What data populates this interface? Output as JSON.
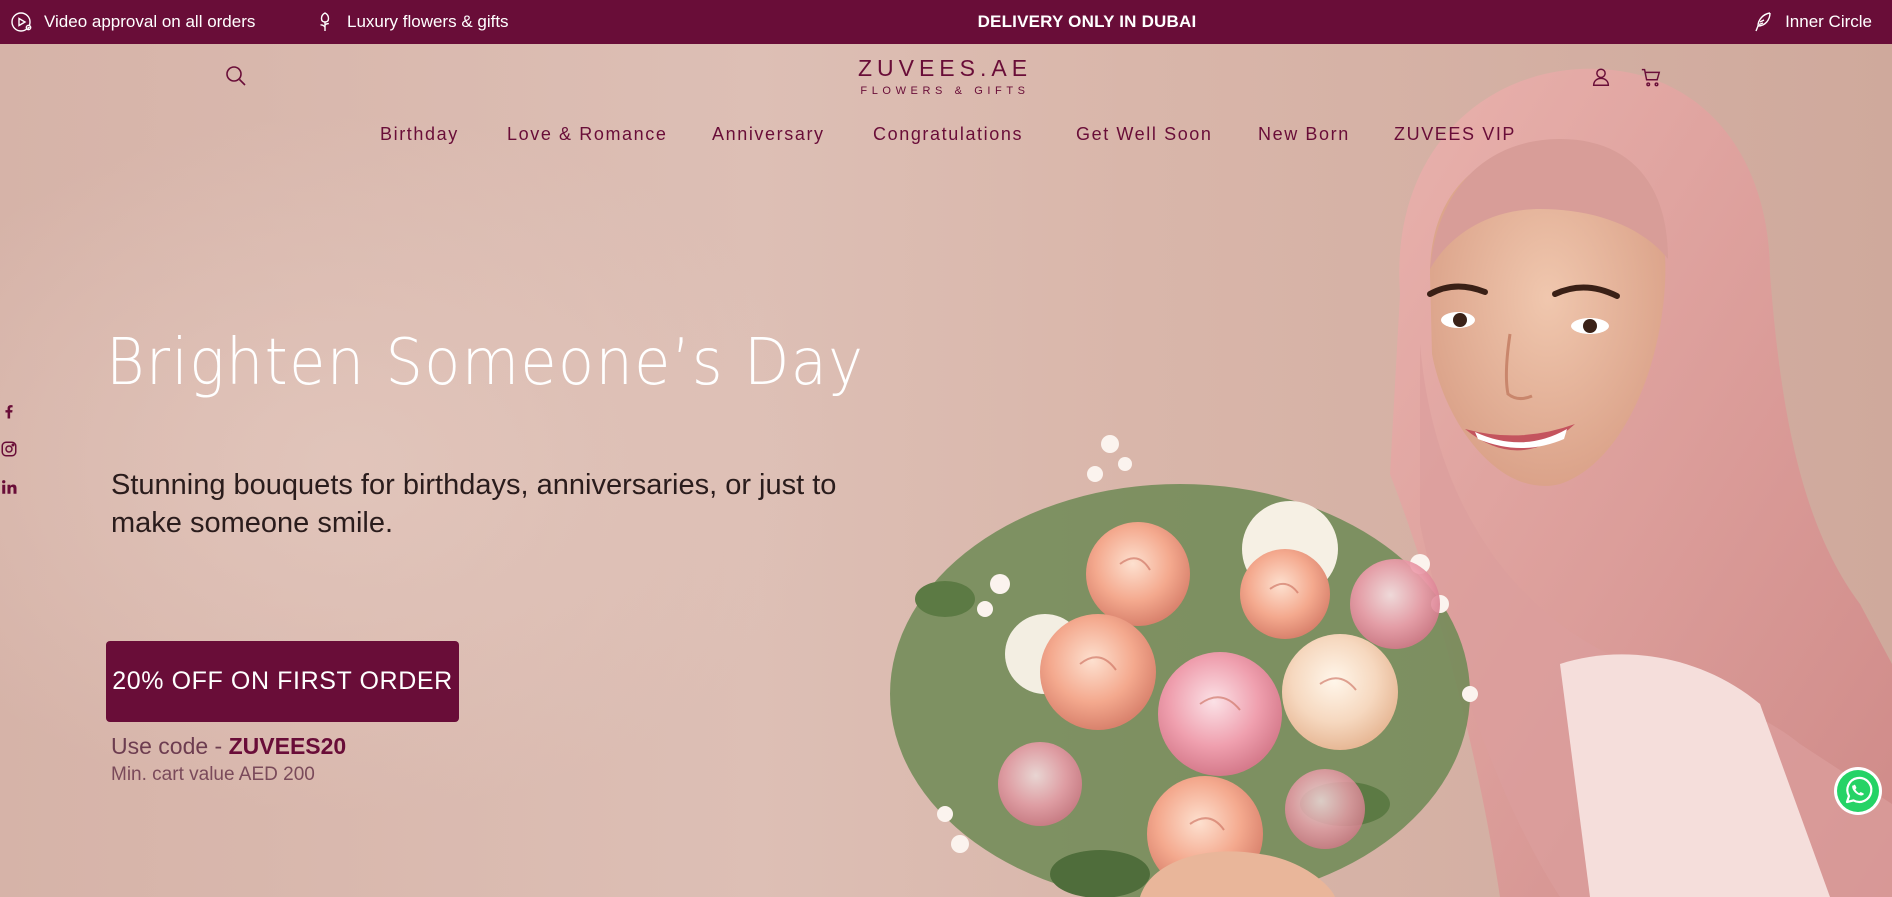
{
  "announcement": {
    "video_label": "Video approval on all orders",
    "luxury_label": "Luxury flowers & gifts",
    "delivery_label": "DELIVERY ONLY IN DUBAI",
    "inner_circle_label": "Inner Circle",
    "background_color": "#690d38"
  },
  "header": {
    "logo_name": "ZUVEES.AE",
    "logo_tagline": "FLOWERS & GIFTS",
    "icons": [
      "search-icon",
      "user-icon",
      "cart-icon"
    ]
  },
  "nav": {
    "items": [
      {
        "label": "Birthday"
      },
      {
        "label": "Love & Romance"
      },
      {
        "label": "Anniversary"
      },
      {
        "label": "Congratulations"
      },
      {
        "label": "Get Well Soon"
      },
      {
        "label": "New Born"
      },
      {
        "label": "ZUVEES VIP"
      }
    ]
  },
  "social": [
    "facebook-icon",
    "instagram-icon",
    "linkedin-icon"
  ],
  "hero": {
    "headline": "Brighten Someone’s Day",
    "subhead": "Stunning bouquets for birthdays, anniversaries, or just to make someone smile.",
    "cta_label": "20% OFF ON FIRST ORDER",
    "code_prefix": "Use code - ",
    "code": "ZUVEES20",
    "min_cart": "Min. cart value AED 200"
  },
  "colors": {
    "brand": "#690d38",
    "hero_background": "#d8b7ac",
    "whatsapp": "#25d366"
  }
}
